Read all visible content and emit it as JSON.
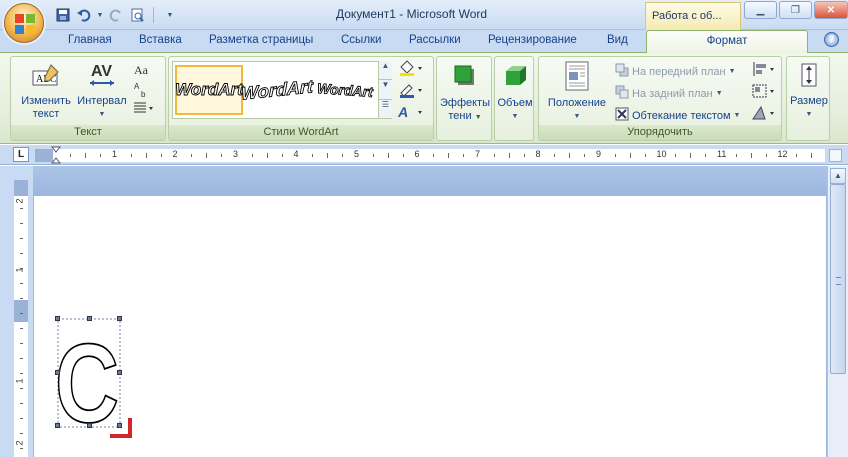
{
  "window": {
    "title": "Документ1 - Microsoft Word",
    "context_title": "Работа с об...",
    "buttons": [
      "minimize",
      "restore",
      "close"
    ]
  },
  "quick_access": {
    "icons": [
      "save-icon",
      "undo-icon",
      "redo-icon",
      "print-preview-icon",
      "customize-icon"
    ]
  },
  "tabs": [
    {
      "label": "Главная"
    },
    {
      "label": "Вставка"
    },
    {
      "label": "Разметка страницы"
    },
    {
      "label": "Ссылки"
    },
    {
      "label": "Рассылки"
    },
    {
      "label": "Рецензирование"
    },
    {
      "label": "Вид"
    }
  ],
  "active_tab": {
    "label": "Формат"
  },
  "ribbon": {
    "text_group": {
      "label": "Текст",
      "edit_text": "Изменить текст",
      "spacing": "Интервал"
    },
    "styles_group": {
      "label": "Стили WordArt",
      "samples": [
        "WordArt",
        "WordArt",
        "WordArt"
      ]
    },
    "shadow": {
      "label": "Эффекты тени"
    },
    "volume": {
      "label": "Объем"
    },
    "arrange_group": {
      "label": "Упорядочить",
      "position": "Положение",
      "bring_forward": "На передний план",
      "send_back": "На задний план",
      "wrap_text": "Обтекание текстом"
    },
    "size": {
      "label": "Размер"
    }
  },
  "ruler": {
    "tab_button": "L",
    "numbers": [
      "1",
      "2",
      "3",
      "4",
      "5",
      "6",
      "7",
      "8",
      "9",
      "10",
      "11",
      "12"
    ]
  },
  "vruler": {
    "numbers": [
      "2",
      "1",
      "1",
      "2"
    ]
  },
  "document": {
    "wordart_letter": "C"
  },
  "colors": {
    "accent_red": "#d3262a",
    "selection_gold": "#f2b940",
    "ribbon_green": "#e4eedb",
    "tab_blue": "#c9dbf2"
  }
}
